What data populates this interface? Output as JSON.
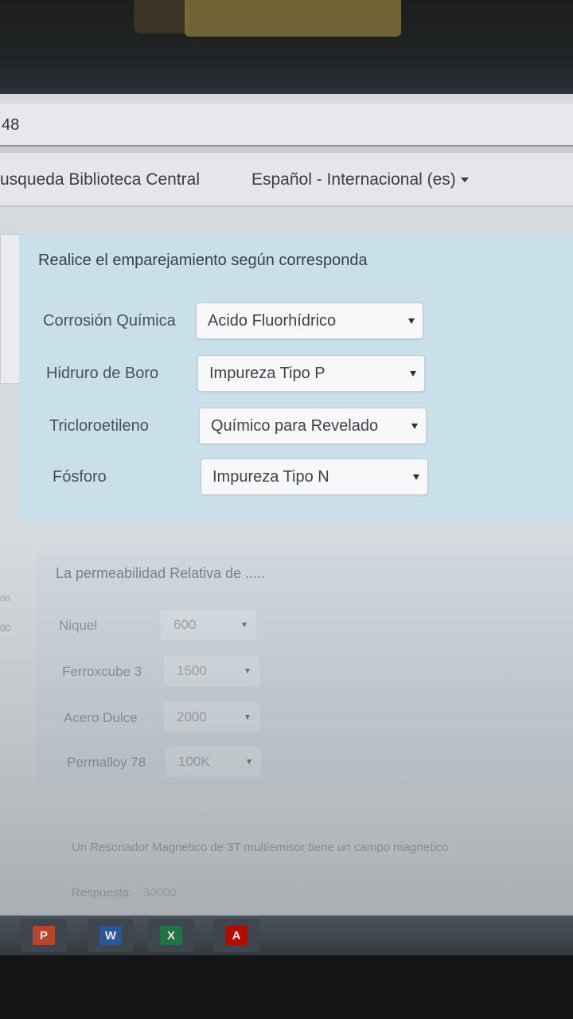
{
  "browser": {
    "address_fragment": "48"
  },
  "navbar": {
    "library_link": "usqueda Biblioteca Central",
    "language_menu": "Español - Internacional (es)"
  },
  "question1": {
    "title": "Realice el emparejamiento según corresponda",
    "rows": [
      {
        "label": "Corrosión Química",
        "selected": "Acido Fluorhídrico"
      },
      {
        "label": "Hidruro de Boro",
        "selected": "Impureza Tipo P"
      },
      {
        "label": "Tricloroetileno",
        "selected": "Químico para Revelado"
      },
      {
        "label": "Fósforo",
        "selected": "Impureza Tipo N"
      }
    ]
  },
  "question2": {
    "title": "La permeabilidad Relativa de .....",
    "rows": [
      {
        "label": "Niquel",
        "selected": "600"
      },
      {
        "label": "Ferroxcube 3",
        "selected": "1500"
      },
      {
        "label": "Acero Dulce",
        "selected": "2000"
      },
      {
        "label": "Permalloy 78",
        "selected": "100K"
      }
    ]
  },
  "question3": {
    "text": "Un Resonador Magnetico de 3T multiemisor tiene un campo magnetico",
    "answer_label": "Respuesta:",
    "answer_value": "30000"
  },
  "left_fragments": {
    "frag1": "ón",
    "frag2": "00"
  },
  "taskbar": {
    "apps": [
      {
        "name": "powerpoint",
        "letter": "P",
        "color": "#b7472a"
      },
      {
        "name": "word",
        "letter": "W",
        "color": "#2b579a"
      },
      {
        "name": "excel",
        "letter": "X",
        "color": "#217346"
      },
      {
        "name": "pdf-reader",
        "letter": "A",
        "color": "#b30b00"
      }
    ]
  }
}
